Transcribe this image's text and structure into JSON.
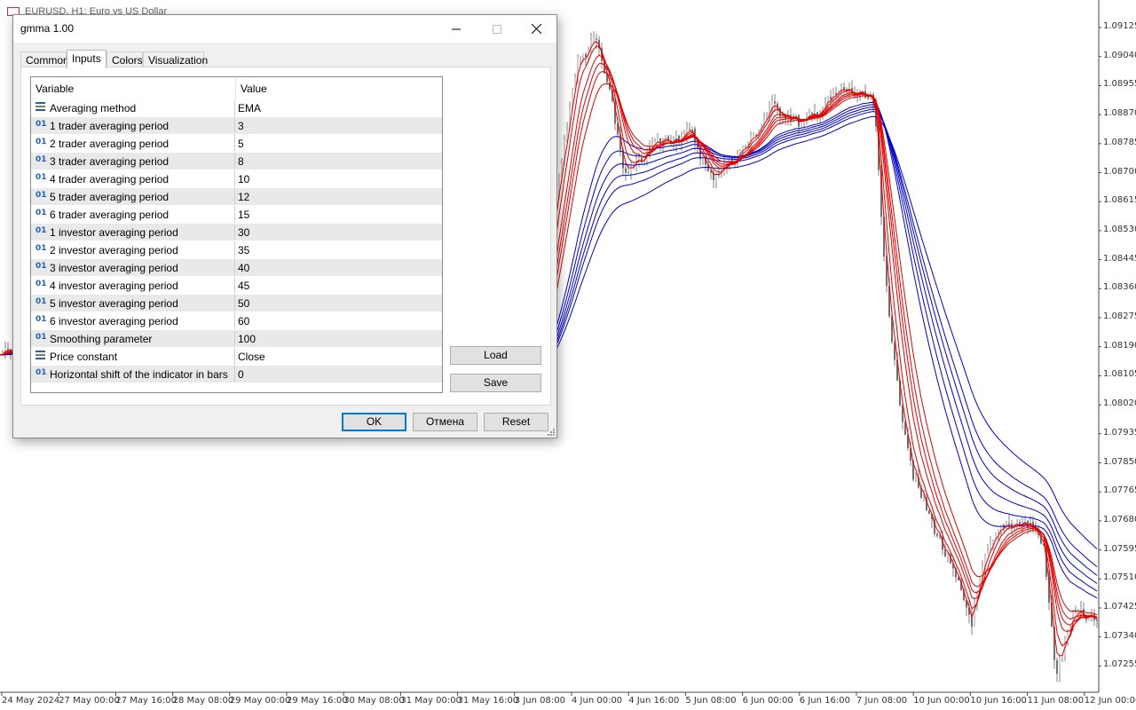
{
  "chart": {
    "title": "EURUSD, H1:  Euro vs US Dollar",
    "price_axis": [
      "1.09125",
      "1.09040",
      "1.08955",
      "1.08870",
      "1.08785",
      "1.08700",
      "1.08615",
      "1.08530",
      "1.08445",
      "1.08360",
      "1.08275",
      "1.08190",
      "1.08105",
      "1.08020",
      "1.07935",
      "1.07850",
      "1.07765",
      "1.07680",
      "1.07595",
      "1.07510",
      "1.07425",
      "1.07340",
      "1.07255"
    ],
    "time_axis": [
      "24 May 2024",
      "27 May 00:00",
      "27 May 16:00",
      "28 May 08:00",
      "29 May 00:00",
      "29 May 16:00",
      "30 May 08:00",
      "31 May 00:00",
      "31 May 16:00",
      "3 Jun 08:00",
      "4 Jun 00:00",
      "4 Jun 16:00",
      "5 Jun 08:00",
      "6 Jun 00:00",
      "6 Jun 16:00",
      "7 Jun 08:00",
      "10 Jun 00:00",
      "10 Jun 16:00",
      "11 Jun 08:00",
      "12 Jun 00:00"
    ],
    "colors": {
      "trader_lines": "#e00000",
      "investor_lines": "#0000c8",
      "candles": "#808080"
    }
  },
  "dialog": {
    "title": "gmma 1.00",
    "tabs": [
      {
        "label": "Common",
        "active": false
      },
      {
        "label": "Inputs",
        "active": true
      },
      {
        "label": "Colors",
        "active": false
      },
      {
        "label": "Visualization",
        "active": false
      }
    ],
    "grid": {
      "col_variable": "Variable",
      "col_value": "Value",
      "rows": [
        {
          "icon": "enum",
          "name": "Averaging method",
          "value": "EMA"
        },
        {
          "icon": "01",
          "name": "1 trader averaging period",
          "value": "3"
        },
        {
          "icon": "01",
          "name": "2 trader averaging period",
          "value": "5"
        },
        {
          "icon": "01",
          "name": "3 trader averaging period",
          "value": "8"
        },
        {
          "icon": "01",
          "name": "4 trader averaging period",
          "value": "10"
        },
        {
          "icon": "01",
          "name": "5 trader averaging period",
          "value": "12"
        },
        {
          "icon": "01",
          "name": "6 trader averaging period",
          "value": "15"
        },
        {
          "icon": "01",
          "name": "1 investor averaging period",
          "value": "30"
        },
        {
          "icon": "01",
          "name": "2 investor averaging period",
          "value": "35"
        },
        {
          "icon": "01",
          "name": "3 investor averaging period",
          "value": "40"
        },
        {
          "icon": "01",
          "name": "4 investor averaging period",
          "value": "45"
        },
        {
          "icon": "01",
          "name": "5 investor averaging period",
          "value": "50"
        },
        {
          "icon": "01",
          "name": "6 investor averaging period",
          "value": "60"
        },
        {
          "icon": "01",
          "name": "Smoothing parameter",
          "value": "100"
        },
        {
          "icon": "enum",
          "name": "Price constant",
          "value": "Close"
        },
        {
          "icon": "01",
          "name": "Horizontal shift of the indicator in bars",
          "value": "0"
        }
      ]
    },
    "buttons": {
      "load": "Load",
      "save": "Save",
      "ok": "OK",
      "cancel": "Отмена",
      "reset": "Reset"
    }
  }
}
